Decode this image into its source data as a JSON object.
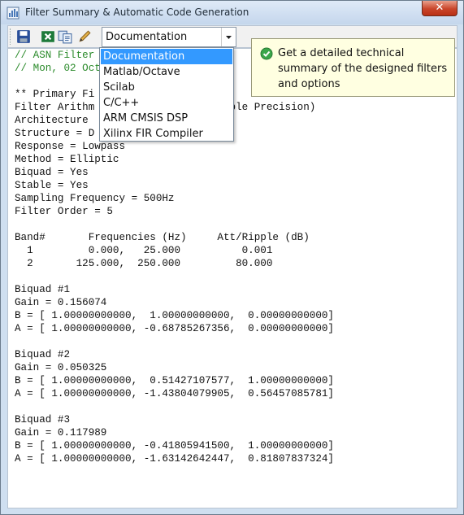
{
  "window": {
    "title": "Filter Summary & Automatic Code Generation",
    "close_label": "✕"
  },
  "toolbar": {
    "icons": [
      "save-icon",
      "excel-icon",
      "copy-icon",
      "pencil-icon"
    ],
    "dropdown_value": "Documentation"
  },
  "dropdown_menu": {
    "options": [
      "Documentation",
      "Matlab/Octave",
      "Scilab",
      "C/C++",
      "ARM CMSIS DSP",
      "Xilinx FIR Compiler"
    ],
    "selected_index": 0
  },
  "tooltip": {
    "text": "Get a detailed technical summary of the designed filters and options"
  },
  "code": {
    "lines": [
      {
        "text": "// ASN Filter                          l v",
        "kind": "comment"
      },
      {
        "text": "// Mon, 02 Oct",
        "kind": "comment"
      },
      {
        "text": "",
        "kind": "plain"
      },
      {
        "text": "** Primary Fi",
        "kind": "plain"
      },
      {
        "text": "Filter Arithm                  (Double Precision)",
        "kind": "plain"
      },
      {
        "text": "Architecture",
        "kind": "plain"
      },
      {
        "text": "Structure = D                  sed",
        "kind": "plain"
      },
      {
        "text": "Response = Lowpass",
        "kind": "plain"
      },
      {
        "text": "Method = Elliptic",
        "kind": "plain"
      },
      {
        "text": "Biquad = Yes",
        "kind": "plain"
      },
      {
        "text": "Stable = Yes",
        "kind": "plain"
      },
      {
        "text": "Sampling Frequency = 500Hz",
        "kind": "plain"
      },
      {
        "text": "Filter Order = 5",
        "kind": "plain"
      },
      {
        "text": "",
        "kind": "plain"
      },
      {
        "text": "Band#       Frequencies (Hz)     Att/Ripple (dB)",
        "kind": "plain"
      },
      {
        "text": "  1         0.000,   25.000          0.001",
        "kind": "plain"
      },
      {
        "text": "  2       125.000,  250.000         80.000",
        "kind": "plain"
      },
      {
        "text": "",
        "kind": "plain"
      },
      {
        "text": "Biquad #1",
        "kind": "plain"
      },
      {
        "text": "Gain = 0.156074",
        "kind": "plain"
      },
      {
        "text": "B = [ 1.00000000000,  1.00000000000,  0.00000000000]",
        "kind": "plain"
      },
      {
        "text": "A = [ 1.00000000000, -0.68785267356,  0.00000000000]",
        "kind": "plain"
      },
      {
        "text": "",
        "kind": "plain"
      },
      {
        "text": "Biquad #2",
        "kind": "plain"
      },
      {
        "text": "Gain = 0.050325",
        "kind": "plain"
      },
      {
        "text": "B = [ 1.00000000000,  0.51427107577,  1.00000000000]",
        "kind": "plain"
      },
      {
        "text": "A = [ 1.00000000000, -1.43804079905,  0.56457085781]",
        "kind": "plain"
      },
      {
        "text": "",
        "kind": "plain"
      },
      {
        "text": "Biquad #3",
        "kind": "plain"
      },
      {
        "text": "Gain = 0.117989",
        "kind": "plain"
      },
      {
        "text": "B = [ 1.00000000000, -0.41805941500,  1.00000000000]",
        "kind": "plain"
      },
      {
        "text": "A = [ 1.00000000000, -1.63142642447,  0.81807837324]",
        "kind": "plain"
      }
    ]
  },
  "colors": {
    "comment": "#2a8a2a",
    "selection": "#3399ff",
    "tooltip_bg": "#ffffe1",
    "close_button": "#c9452a"
  }
}
